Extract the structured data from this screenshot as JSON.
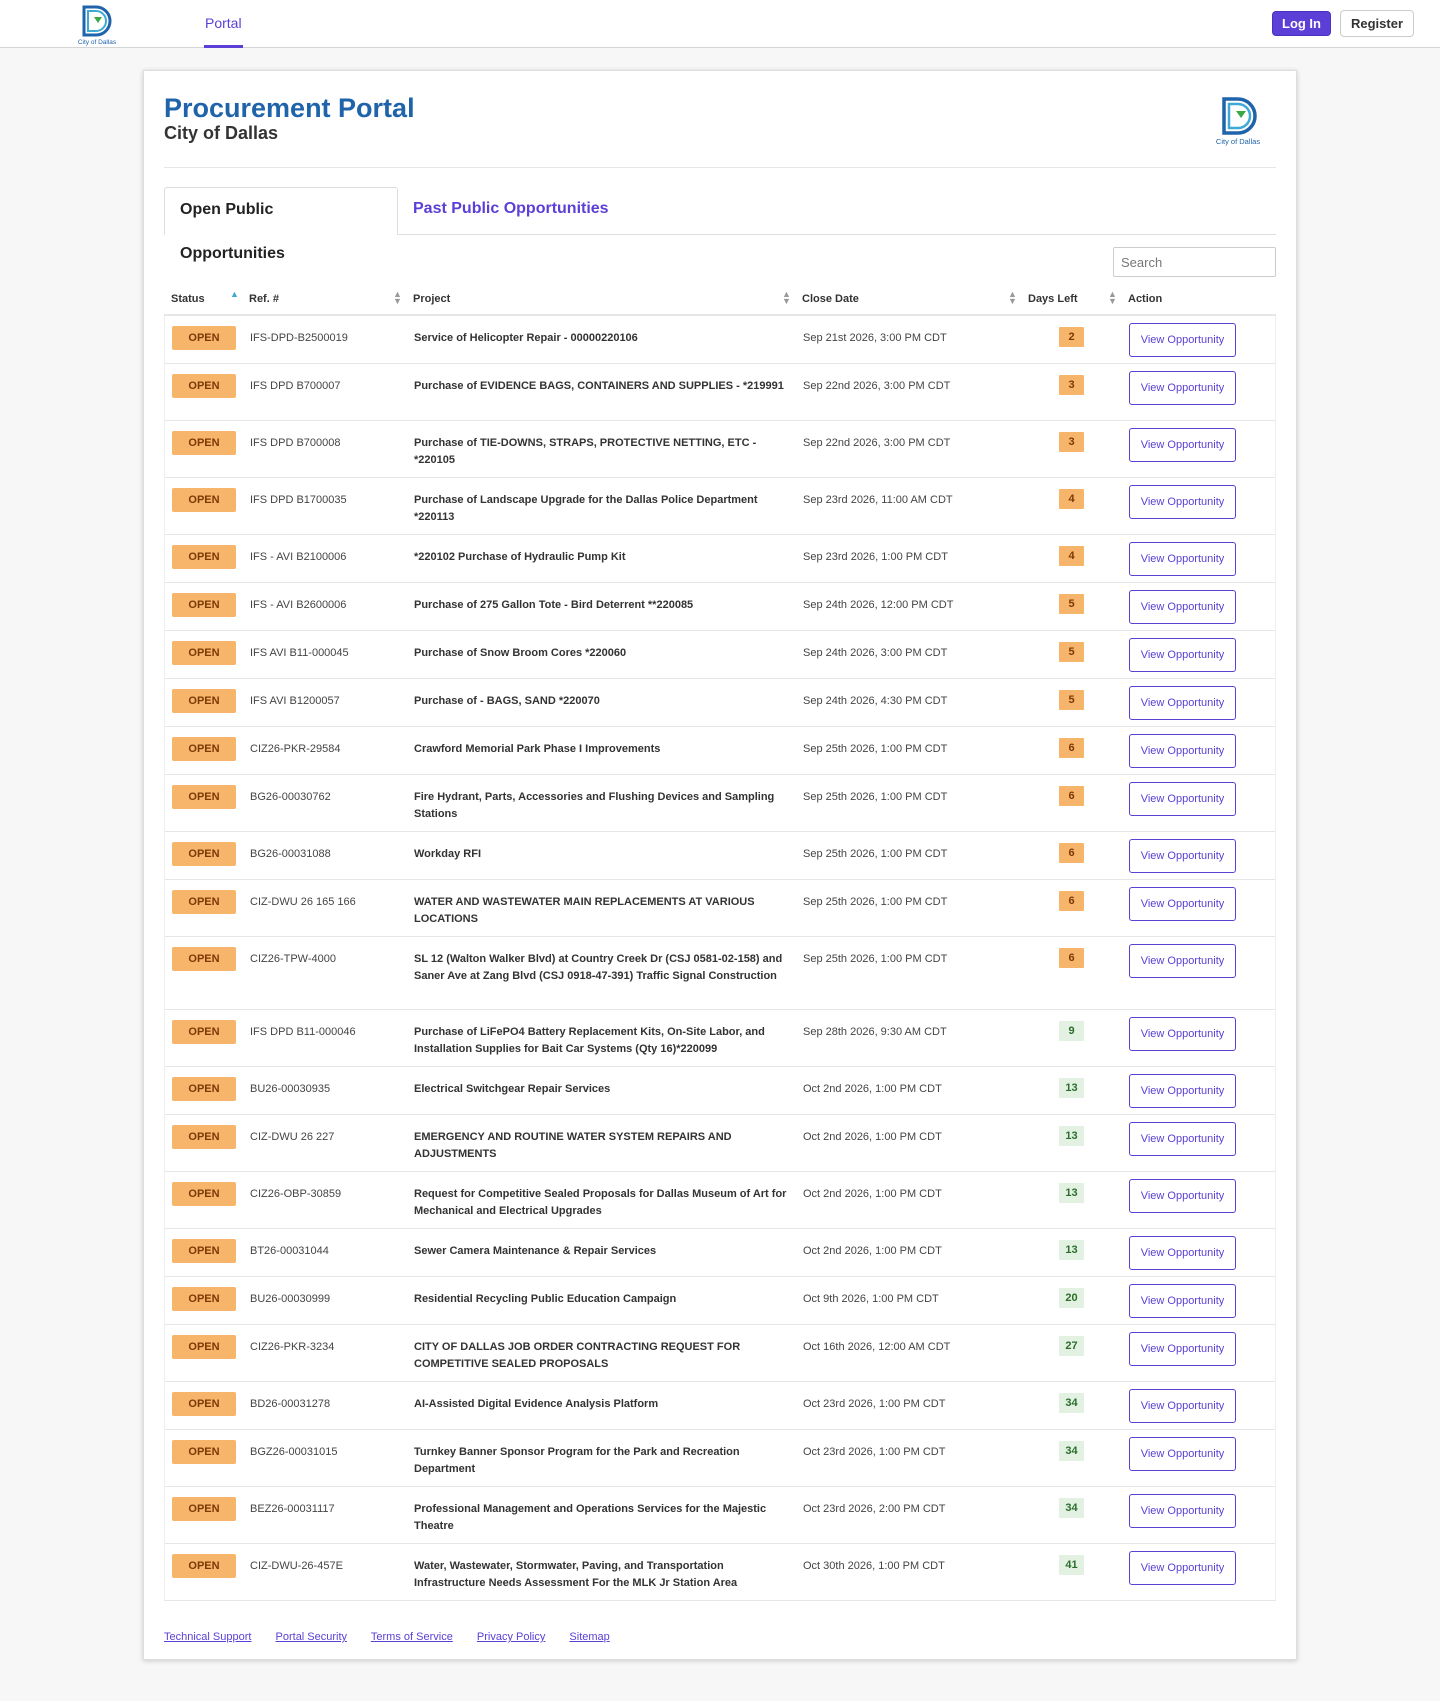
{
  "nav": {
    "logo_caption": "City of Dallas",
    "portal_label": "Portal",
    "login_label": "Log In",
    "register_label": "Register"
  },
  "header": {
    "title": "Procurement Portal",
    "subtitle": "City of Dallas",
    "logo_caption": "City of Dallas"
  },
  "tabs": {
    "open_label": "Open Public Opportunities",
    "past_label": "Past Public Opportunities"
  },
  "search": {
    "placeholder": "Search"
  },
  "table": {
    "columns": {
      "status": "Status",
      "ref": "Ref. #",
      "project": "Project",
      "close_date": "Close Date",
      "days_left": "Days Left",
      "action": "Action"
    },
    "rows": [
      {
        "status": "OPEN",
        "ref": "IFS-DPD-B2500019",
        "project": "Service of Helicopter Repair - 00000220106",
        "close_date": "Sep 21st 2026, 3:00 PM CDT",
        "days_left": "2",
        "action": "View Opportunity"
      },
      {
        "status": "OPEN",
        "ref": "IFS DPD B700007",
        "project": "Purchase of EVIDENCE BAGS, CONTAINERS AND SUPPLIES - *219991",
        "close_date": "Sep 22nd 2026, 3:00 PM CDT",
        "days_left": "3",
        "action": "View Opportunity"
      },
      {
        "status": "OPEN",
        "ref": "IFS DPD B700008",
        "project": "Purchase of TIE-DOWNS, STRAPS, PROTECTIVE NETTING, ETC - *220105",
        "close_date": "Sep 22nd 2026, 3:00 PM CDT",
        "days_left": "3",
        "action": "View Opportunity"
      },
      {
        "status": "OPEN",
        "ref": "IFS DPD B1700035",
        "project": "Purchase of Landscape Upgrade for the Dallas Police Department *220113",
        "close_date": "Sep 23rd 2026, 11:00 AM CDT",
        "days_left": "4",
        "action": "View Opportunity"
      },
      {
        "status": "OPEN",
        "ref": "IFS - AVI B2100006",
        "project": "*220102 Purchase of Hydraulic Pump Kit",
        "close_date": "Sep 23rd 2026, 1:00 PM CDT",
        "days_left": "4",
        "action": "View Opportunity"
      },
      {
        "status": "OPEN",
        "ref": "IFS - AVI B2600006",
        "project": "Purchase of 275 Gallon Tote - Bird Deterrent **220085",
        "close_date": "Sep 24th 2026, 12:00 PM CDT",
        "days_left": "5",
        "action": "View Opportunity"
      },
      {
        "status": "OPEN",
        "ref": "IFS AVI B11-000045",
        "project": "Purchase of Snow Broom Cores *220060",
        "close_date": "Sep 24th 2026, 3:00 PM CDT",
        "days_left": "5",
        "action": "View Opportunity"
      },
      {
        "status": "OPEN",
        "ref": "IFS AVI B1200057",
        "project": "Purchase of - BAGS, SAND *220070",
        "close_date": "Sep 24th 2026, 4:30 PM CDT",
        "days_left": "5",
        "action": "View Opportunity"
      },
      {
        "status": "OPEN",
        "ref": "CIZ26-PKR-29584",
        "project": "Crawford Memorial Park Phase I Improvements",
        "close_date": "Sep 25th 2026, 1:00 PM CDT",
        "days_left": "6",
        "action": "View Opportunity"
      },
      {
        "status": "OPEN",
        "ref": "BG26-00030762",
        "project": "Fire Hydrant, Parts, Accessories and Flushing Devices and Sampling Stations",
        "close_date": "Sep 25th 2026, 1:00 PM CDT",
        "days_left": "6",
        "action": "View Opportunity"
      },
      {
        "status": "OPEN",
        "ref": "BG26-00031088",
        "project": "Workday RFI",
        "close_date": "Sep 25th 2026, 1:00 PM CDT",
        "days_left": "6",
        "action": "View Opportunity"
      },
      {
        "status": "OPEN",
        "ref": "CIZ-DWU 26 165 166",
        "project": "WATER AND WASTEWATER MAIN REPLACEMENTS AT VARIOUS LOCATIONS",
        "close_date": "Sep 25th 2026, 1:00 PM CDT",
        "days_left": "6",
        "action": "View Opportunity"
      },
      {
        "status": "OPEN",
        "ref": "CIZ26-TPW-4000",
        "project": "SL 12 (Walton Walker Blvd) at Country Creek Dr (CSJ 0581-02-158) and Saner Ave at Zang Blvd (CSJ 0918-47-391) Traffic Signal Construction",
        "close_date": "Sep 25th 2026, 1:00 PM CDT",
        "days_left": "6",
        "action": "View Opportunity"
      },
      {
        "status": "OPEN",
        "ref": "IFS DPD B11-000046",
        "project": "Purchase of LiFePO4 Battery Replacement Kits, On-Site Labor, and Installation Supplies for Bait Car Systems (Qty 16)*220099",
        "close_date": "Sep 28th 2026, 9:30 AM CDT",
        "days_left": "9",
        "action": "View Opportunity"
      },
      {
        "status": "OPEN",
        "ref": "BU26-00030935",
        "project": "Electrical Switchgear Repair Services",
        "close_date": "Oct 2nd 2026, 1:00 PM CDT",
        "days_left": "13",
        "action": "View Opportunity"
      },
      {
        "status": "OPEN",
        "ref": "CIZ-DWU 26 227",
        "project": "EMERGENCY AND ROUTINE WATER SYSTEM REPAIRS AND ADJUSTMENTS",
        "close_date": "Oct 2nd 2026, 1:00 PM CDT",
        "days_left": "13",
        "action": "View Opportunity"
      },
      {
        "status": "OPEN",
        "ref": "CIZ26-OBP-30859",
        "project": "Request for Competitive Sealed Proposals for Dallas Museum of Art for Mechanical and Electrical Upgrades",
        "close_date": "Oct 2nd 2026, 1:00 PM CDT",
        "days_left": "13",
        "action": "View Opportunity"
      },
      {
        "status": "OPEN",
        "ref": "BT26-00031044",
        "project": "Sewer Camera Maintenance & Repair Services",
        "close_date": "Oct 2nd 2026, 1:00 PM CDT",
        "days_left": "13",
        "action": "View Opportunity"
      },
      {
        "status": "OPEN",
        "ref": "BU26-00030999",
        "project": "Residential Recycling Public Education Campaign",
        "close_date": "Oct 9th 2026, 1:00 PM CDT",
        "days_left": "20",
        "action": "View Opportunity"
      },
      {
        "status": "OPEN",
        "ref": "CIZ26-PKR-3234",
        "project": "CITY OF DALLAS JOB ORDER CONTRACTING REQUEST FOR COMPETITIVE SEALED PROPOSALS",
        "close_date": "Oct 16th 2026, 12:00 AM CDT",
        "days_left": "27",
        "action": "View Opportunity"
      },
      {
        "status": "OPEN",
        "ref": "BD26-00031278",
        "project": "AI-Assisted Digital Evidence Analysis Platform",
        "close_date": "Oct 23rd 2026, 1:00 PM CDT",
        "days_left": "34",
        "action": "View Opportunity"
      },
      {
        "status": "OPEN",
        "ref": "BGZ26-00031015",
        "project": "Turnkey Banner Sponsor Program for the Park and Recreation Department",
        "close_date": "Oct 23rd 2026, 1:00 PM CDT",
        "days_left": "34",
        "action": "View Opportunity"
      },
      {
        "status": "OPEN",
        "ref": "BEZ26-00031117",
        "project": "Professional Management and Operations Services for the Majestic Theatre",
        "close_date": "Oct 23rd 2026, 2:00 PM CDT",
        "days_left": "34",
        "action": "View Opportunity"
      },
      {
        "status": "OPEN",
        "ref": "CIZ-DWU-26-457E",
        "project": "Water, Wastewater, Stormwater, Paving, and Transportation Infrastructure Needs Assessment For the MLK Jr Station Area",
        "close_date": "Oct 30th 2026, 1:00 PM CDT",
        "days_left": "41",
        "action": "View Opportunity"
      }
    ]
  },
  "footer": {
    "links": [
      "Technical Support",
      "Portal Security",
      "Terms of Service",
      "Privacy Policy",
      "Sitemap"
    ]
  },
  "colors": {
    "brand_purple": "#5b3fd6",
    "title_blue": "#1f63aa",
    "open_badge": "#f7b46b",
    "days_orange": "#f7b46b",
    "days_green": "#e2f1e2"
  },
  "icons": {
    "logo": "city-of-dallas-logo",
    "sort": "sort-arrows-icon"
  }
}
